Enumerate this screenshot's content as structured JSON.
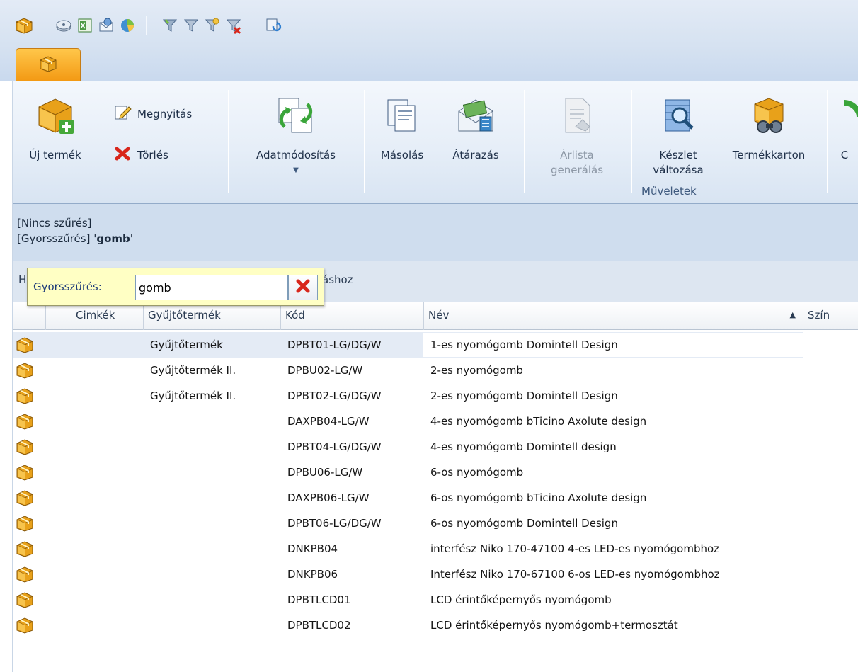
{
  "quick_access": {
    "icons": [
      "box-app-icon",
      "cd-icon",
      "excel-icon",
      "mail-icon",
      "chart-icon",
      "filter-icon",
      "filter-icon",
      "filter-icon",
      "filter-clear-icon",
      "refresh-icon"
    ]
  },
  "ribbon": {
    "new_product": "Új termék",
    "open": "Megnyitás",
    "delete": "Törlés",
    "modify": "Adatmódosítás",
    "copy": "Másolás",
    "reprice": "Átárazás",
    "pricelist_line1": "Árlista",
    "pricelist_line2": "generálás",
    "stock_line1": "Készlet",
    "stock_line2": "változása",
    "product_card": "Termékkarton",
    "cut_label": "C",
    "group_label": "Műveletek"
  },
  "filter_info": {
    "line1": "[Nincs szűrés]",
    "line2_prefix": "[Gyorsszűrés] '",
    "line2_term": "gomb",
    "line2_suffix": "'"
  },
  "groupby": {
    "hint_start": "H",
    "hint_end": "áshoz"
  },
  "quick_filter": {
    "label": "Gyorsszűrés:",
    "value": "gomb"
  },
  "grid": {
    "columns": [
      "Cimkék",
      "Gyűjtőtermék",
      "Kód",
      "Név",
      "Szín"
    ],
    "sort_indicator": "▲",
    "rows": [
      {
        "group": "Gyűjtőtermék",
        "code": "DPBT01-LG/DG/W",
        "name": "1-es nyomógomb Domintell Design"
      },
      {
        "group": "Gyűjtőtermék II.",
        "code": "DPBU02-LG/W",
        "name": "2-es nyomógomb"
      },
      {
        "group": "Gyűjtőtermék II.",
        "code": "DPBT02-LG/DG/W",
        "name": "2-es nyomógomb Domintell Design"
      },
      {
        "group": "",
        "code": "DAXPB04-LG/W",
        "name": "4-es nyomógomb bTicino Axolute design"
      },
      {
        "group": "",
        "code": "DPBT04-LG/DG/W",
        "name": "4-es nyomógomb Domintell design"
      },
      {
        "group": "",
        "code": "DPBU06-LG/W",
        "name": "6-os nyomógomb"
      },
      {
        "group": "",
        "code": "DAXPB06-LG/W",
        "name": "6-os nyomógomb bTicino Axolute design"
      },
      {
        "group": "",
        "code": "DPBT06-LG/DG/W",
        "name": "6-os nyomógomb Domintell Design"
      },
      {
        "group": "",
        "code": "DNKPB04",
        "name": "interfész Niko 170-47100 4-es LED-es nyomógombhoz"
      },
      {
        "group": "",
        "code": "DNKPB06",
        "name": "Interfész Niko 170-67100 6-os LED-es nyomógombhoz"
      },
      {
        "group": "",
        "code": "DPBTLCD01",
        "name": "LCD érintőképernyős nyomógomb"
      },
      {
        "group": "",
        "code": "DPBTLCD02",
        "name": "LCD érintőképernyős nyomógomb+termosztát"
      }
    ]
  },
  "colors": {
    "accent": "#f39a14",
    "ribbon_bg": "#e6eef8",
    "filter_bg": "#cfddee",
    "quick_filter_bg": "#ffffc4"
  }
}
